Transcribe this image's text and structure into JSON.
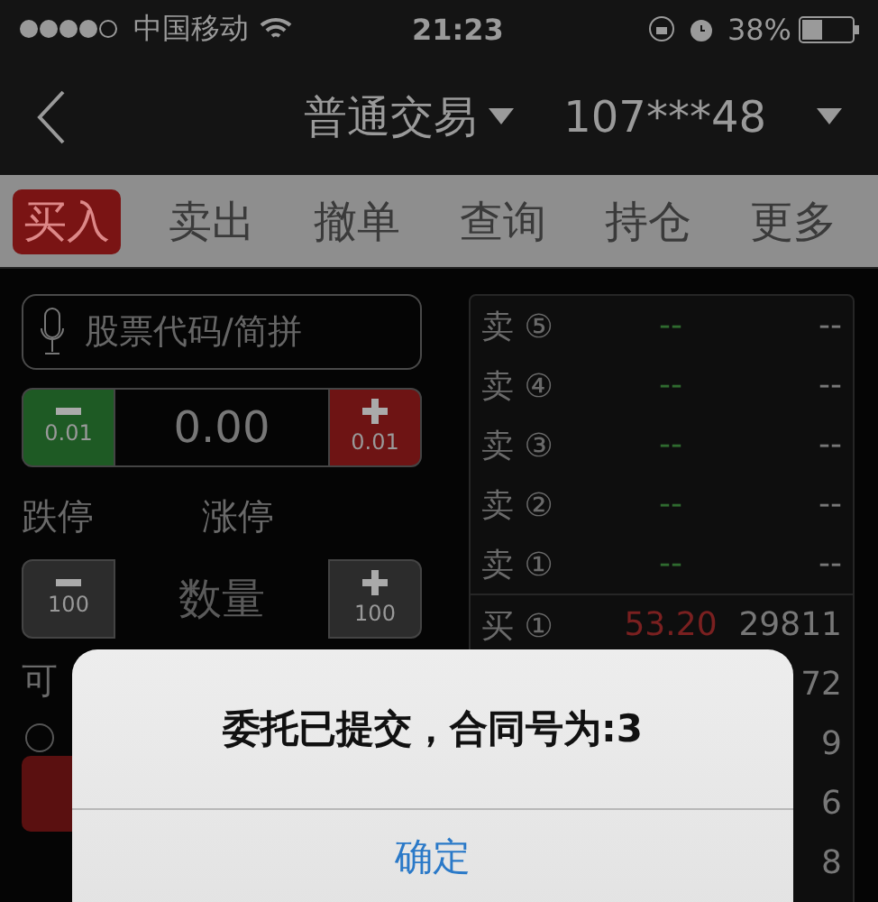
{
  "status_bar": {
    "carrier": "中国移动",
    "time": "21:23",
    "battery": "38%"
  },
  "nav": {
    "title": "普通交易",
    "account": "107***48"
  },
  "tabs": [
    {
      "label": "买入",
      "selected": true
    },
    {
      "label": "卖出",
      "selected": false
    },
    {
      "label": "撤单",
      "selected": false
    },
    {
      "label": "查询",
      "selected": false
    },
    {
      "label": "持仓",
      "selected": false
    },
    {
      "label": "更多",
      "selected": false
    }
  ],
  "search": {
    "placeholder": "股票代码/简拼"
  },
  "price_stepper": {
    "minus_step": "0.01",
    "value": "0.00",
    "plus_step": "0.01"
  },
  "limit_labels": [
    "跌停",
    "涨停"
  ],
  "quantity_stepper": {
    "minus_step": "100",
    "placeholder": "数量",
    "plus_step": "100"
  },
  "available_label": "可",
  "radio": {
    "checked": false
  },
  "order_book": {
    "sell": [
      {
        "label": "卖 ⑤",
        "price": "--",
        "volume": "--"
      },
      {
        "label": "卖 ④",
        "price": "--",
        "volume": "--"
      },
      {
        "label": "卖 ③",
        "price": "--",
        "volume": "--"
      },
      {
        "label": "卖 ②",
        "price": "--",
        "volume": "--"
      },
      {
        "label": "卖 ①",
        "price": "--",
        "volume": "--"
      }
    ],
    "buy": [
      {
        "label": "买 ①",
        "price": "53.20",
        "volume": "29811"
      },
      {
        "volume": "72"
      },
      {
        "volume": "9"
      },
      {
        "volume": "6"
      },
      {
        "volume": "8"
      }
    ]
  },
  "dialog": {
    "message": "委托已提交，合同号为:3",
    "button": "确定"
  }
}
